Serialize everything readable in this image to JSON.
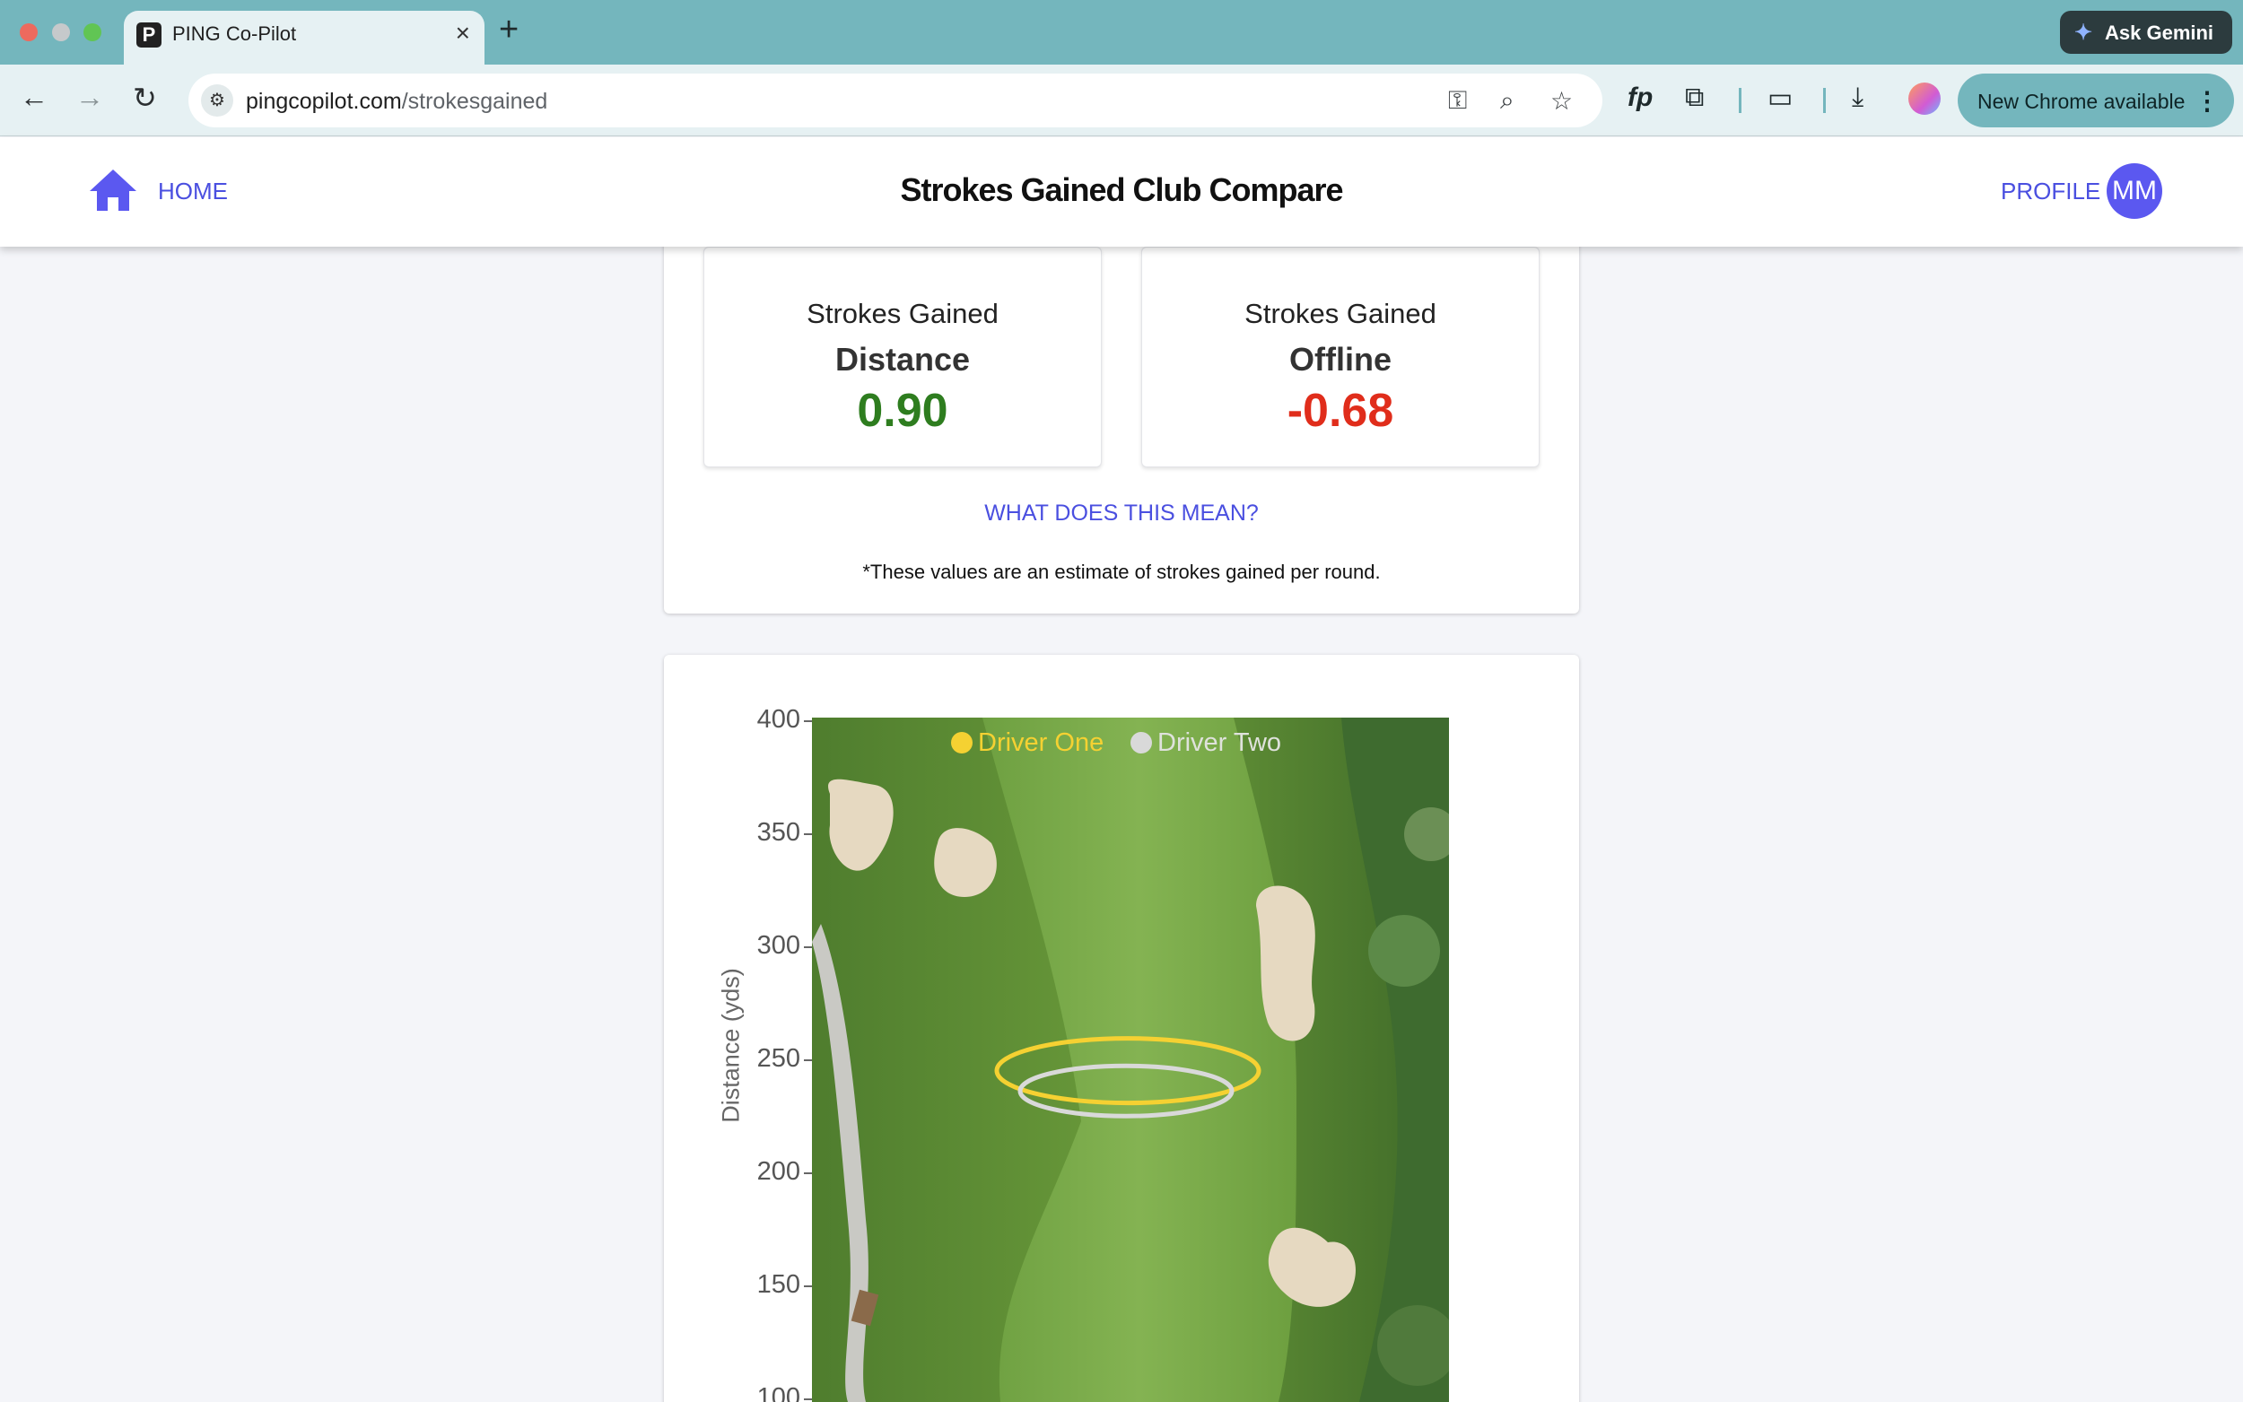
{
  "browser": {
    "tab_title": "PING Co-Pilot",
    "url_host": "pingcopilot.com",
    "url_path": "/strokesgained",
    "ask_gemini": "Ask Gemini",
    "update_label": "New Chrome available"
  },
  "header": {
    "home_label": "HOME",
    "title": "Strokes Gained Club Compare",
    "profile_label": "PROFILE",
    "avatar_initials": "MM"
  },
  "strokes_gained": {
    "distance": {
      "title": "Strokes Gained",
      "subtitle": "Distance",
      "value": "0.90",
      "color": "#2e7d1f"
    },
    "offline": {
      "title": "Strokes Gained",
      "subtitle": "Offline",
      "value": "-0.68",
      "color": "#e02d1b"
    },
    "what_link": "WHAT DOES THIS MEAN?",
    "note": "*These values are an estimate of strokes gained per round."
  },
  "chart_data": {
    "type": "scatter",
    "ylabel": "Distance (yds)",
    "yticks": [
      "400",
      "350",
      "300",
      "250",
      "200",
      "150",
      "100"
    ],
    "ylim": [
      100,
      400
    ],
    "series": [
      {
        "name": "Driver One",
        "color": "#f5d132",
        "center_distance": 245
      },
      {
        "name": "Driver Two",
        "color": "#d9d9d9",
        "center_distance": 236
      }
    ]
  }
}
